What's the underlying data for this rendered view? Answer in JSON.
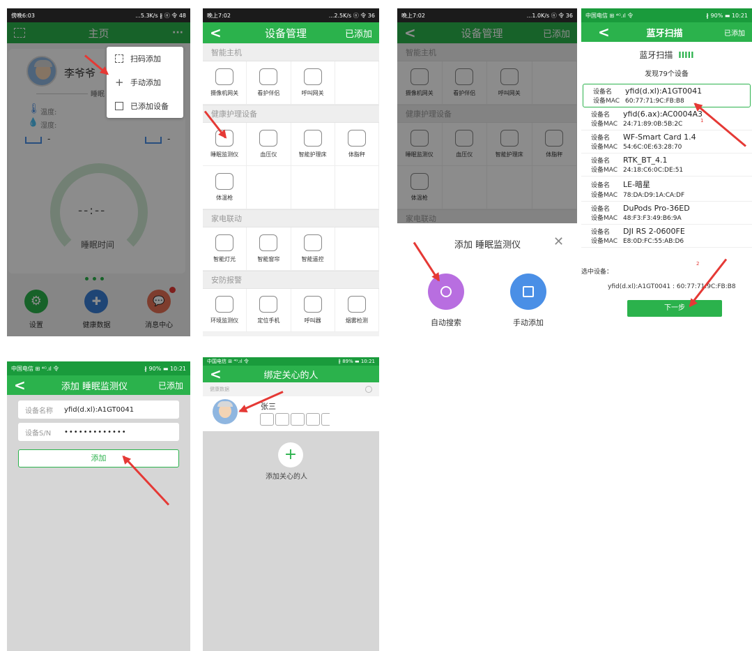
{
  "p1": {
    "status": {
      "time": "傍晚6:03",
      "right": "...5.3K/s ∦ ⓝ 令 48"
    },
    "title": "主页",
    "more": "···",
    "user_name": "李爷爷",
    "section_label": "睡眠",
    "temp_label": "温度:",
    "humidity_label": "湿度:",
    "dash_left": "-",
    "dash_right": "-",
    "gauge_value": "--:--",
    "gauge_label": "睡眠时间",
    "menu": [
      {
        "label": "扫码添加"
      },
      {
        "label": "手动添加"
      },
      {
        "label": "已添加设备"
      }
    ],
    "nav": [
      {
        "label": "设置"
      },
      {
        "label": "健康数据"
      },
      {
        "label": "消息中心"
      }
    ]
  },
  "p2": {
    "status": {
      "time": "晚上7:02",
      "right": "...2.5K/s ⓝ 令 36"
    },
    "title": "设备管理",
    "right": "已添加",
    "sections": [
      {
        "title": "智能主机",
        "items": [
          "摄像机网关",
          "看护伴侣",
          "呼叫网关"
        ]
      },
      {
        "title": "健康护理设备",
        "items": [
          "睡眠监测仪",
          "血压仪",
          "智能护理床",
          "体脂秤",
          "体温枪"
        ]
      },
      {
        "title": "家电联动",
        "items": [
          "智能灯光",
          "智能窗帘",
          "智能遥控"
        ]
      },
      {
        "title": "安防报警",
        "items": [
          "环境监测仪",
          "定位手机",
          "呼叫器",
          "烟雾检测"
        ]
      }
    ]
  },
  "p3": {
    "status": {
      "time": "晚上7:02",
      "right": "...1.0K/s ⓝ 令 36"
    },
    "title": "设备管理",
    "right": "已添加",
    "sections": [
      {
        "title": "智能主机",
        "items": [
          "摄像机网关",
          "看护伴侣",
          "呼叫网关"
        ]
      },
      {
        "title": "健康护理设备",
        "items": [
          "睡眠监测仪",
          "血压仪",
          "智能护理床",
          "体脂秤",
          "体温枪"
        ]
      },
      {
        "title": "家电联动",
        "items": []
      }
    ],
    "dialog_title": "添加 睡眠监测仪",
    "close": "✕",
    "opt_auto": "自动搜索",
    "opt_manual": "手动添加"
  },
  "p4": {
    "status": {
      "left": "中国电信 ⊞ ⁴ᴳ.ıl 令",
      "right": "∦ 90% ▬ 10:21"
    },
    "title": "蓝牙扫描",
    "right": "已添加",
    "scan_title": "蓝牙扫描",
    "scan_bars": "IIIII",
    "found": "发现79个设备",
    "name_label": "设备名",
    "mac_label": "设备MAC",
    "devices": [
      {
        "name": "yfid(d.xl):A1GT0041",
        "mac": "60:77:71:9C:FB:B8"
      },
      {
        "name": "yfid(6.ax):AC0004A3",
        "mac": "24:71:89:0B:5B:2C"
      },
      {
        "name": "WF-Smart Card 1.4",
        "mac": "54:6C:0E:63:28:70"
      },
      {
        "name": "RTK_BT_4.1",
        "mac": "24:18:C6:0C:DE:51"
      },
      {
        "name": "LE-暗星",
        "mac": "78:DA:D9:1A:CA:DF"
      },
      {
        "name": "DuPods Pro-36ED",
        "mac": "48:F3:F3:49:B6:9A"
      },
      {
        "name": "DJI RS 2-0600FE",
        "mac": "E8:0D:FC:55:AB:D6"
      }
    ],
    "mark1": "1",
    "mark2": "2",
    "selected_label": "选中设备：",
    "selected_value": "yfid(d.xl):A1GT0041 : 60:77:71:9C:FB:B8",
    "next": "下一步"
  },
  "p5": {
    "status": {
      "left": "中国电信 ⊞ ⁴ᴳ.ıl 令",
      "right": "∦ 90% ▬ 10:21"
    },
    "title": "添加 睡眠监测仪",
    "right": "已添加",
    "name_label": "设备名称",
    "name_value": "yfid(d.xl):A1GT0041",
    "sn_label": "设备S/N",
    "sn_value": "•••••••••••••",
    "add": "添加"
  },
  "p6": {
    "status": {
      "left": "中国电信 ⊞ ⁴ᴳ.ıl 令",
      "right": "∦ 89% ▬ 10:21"
    },
    "title": "绑定关心的人",
    "crumb": "健康数据",
    "person": "张三",
    "add_label": "添加关心的人",
    "plus": "+"
  },
  "colors": {
    "green": "#2bb24c",
    "red_arrow": "#e53935",
    "purple": "#b86ee0",
    "blue": "#4a8fe6"
  }
}
